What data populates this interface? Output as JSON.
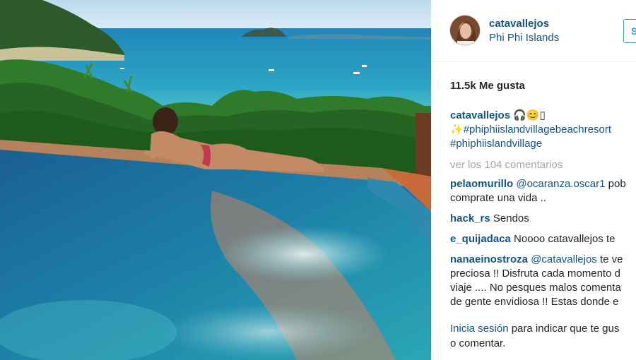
{
  "post": {
    "username": "catavallejos",
    "location": "Phi Phi Islands",
    "follow_label": "S",
    "likes": "11.5k Me gusta"
  },
  "caption": {
    "username": "catavallejos",
    "emoji": "🎧😊▯",
    "sparkle": "✨",
    "hashtag1": "#phiphiislandvillagebeachresort",
    "hashtag2": "#phiphiislandvillage"
  },
  "view_comments": "ver los 104 comentarios",
  "comments": [
    {
      "user": "pelaomurillo",
      "mention": "@ocaranza.oscar1",
      "line1": " pob",
      "line2": "comprate una vida .."
    },
    {
      "user": "hack_rs",
      "text": " Sendos"
    },
    {
      "user": "e_quijadaca",
      "text": " Noooo catavallejos te"
    },
    {
      "user": "nanaeinostroza",
      "mention": "@catavallejos",
      "line1": " te ve",
      "line2": "preciosa !! Disfruta cada momento d",
      "line3": "viaje .... No pesques malos comenta",
      "line4": "de gente envidiosa !! Estas donde e"
    }
  ],
  "login": {
    "link": "Inicia sesión",
    "text1": " para indicar que te gus",
    "text2": "o comentar."
  },
  "colors": {
    "link_blue": "#125688",
    "follow_blue": "#3897f0",
    "muted": "#a5a7aa"
  }
}
